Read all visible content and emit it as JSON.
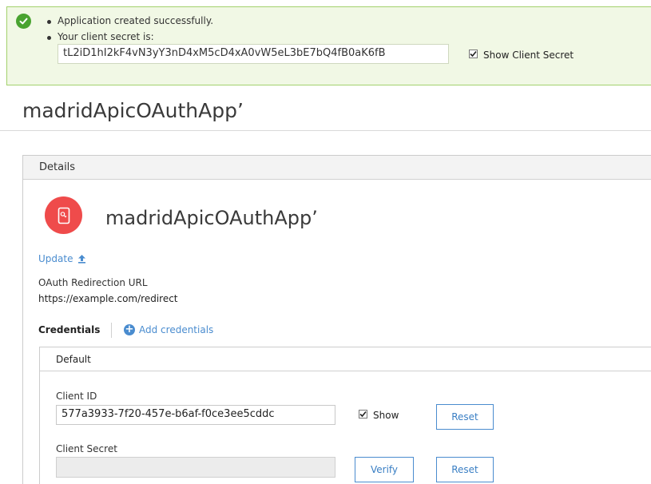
{
  "banner": {
    "messages": [
      "Application created successfully.",
      "Your client secret is:"
    ],
    "client_secret": "tL2iD1hI2kF4vN3yY3nD4xM5cD4xA0vW5eL3bE7bQ4fB0aK6fB",
    "show_secret_label": "Show Client Secret",
    "show_secret_checked": true
  },
  "page": {
    "title": "madridApicOAuthApp’"
  },
  "details": {
    "header": "Details",
    "app_name": "madridApicOAuthApp’",
    "update_label": "Update",
    "oauth_label": "OAuth Redirection URL",
    "oauth_value": "https://example.com/redirect"
  },
  "credentials": {
    "title": "Credentials",
    "add_label": "Add credentials",
    "default_label": "Default",
    "client_id_label": "Client ID",
    "client_id_value": "577a3933-7f20-457e-b6af-f0ce3ee5cddc",
    "show_label": "Show",
    "show_checked": true,
    "reset_label": "Reset",
    "client_secret_label": "Client Secret",
    "client_secret_value": "",
    "verify_label": "Verify"
  },
  "colors": {
    "success_bg": "#f1f8e5",
    "success_border": "#a3d16d",
    "success_icon": "#49a330",
    "app_icon": "#ef4b4b",
    "link": "#4a8ccf"
  },
  "icons": {
    "success": "check-circle-icon",
    "app": "mobile-app-icon",
    "update": "upload-arrow-icon",
    "add": "plus-circle-icon"
  }
}
